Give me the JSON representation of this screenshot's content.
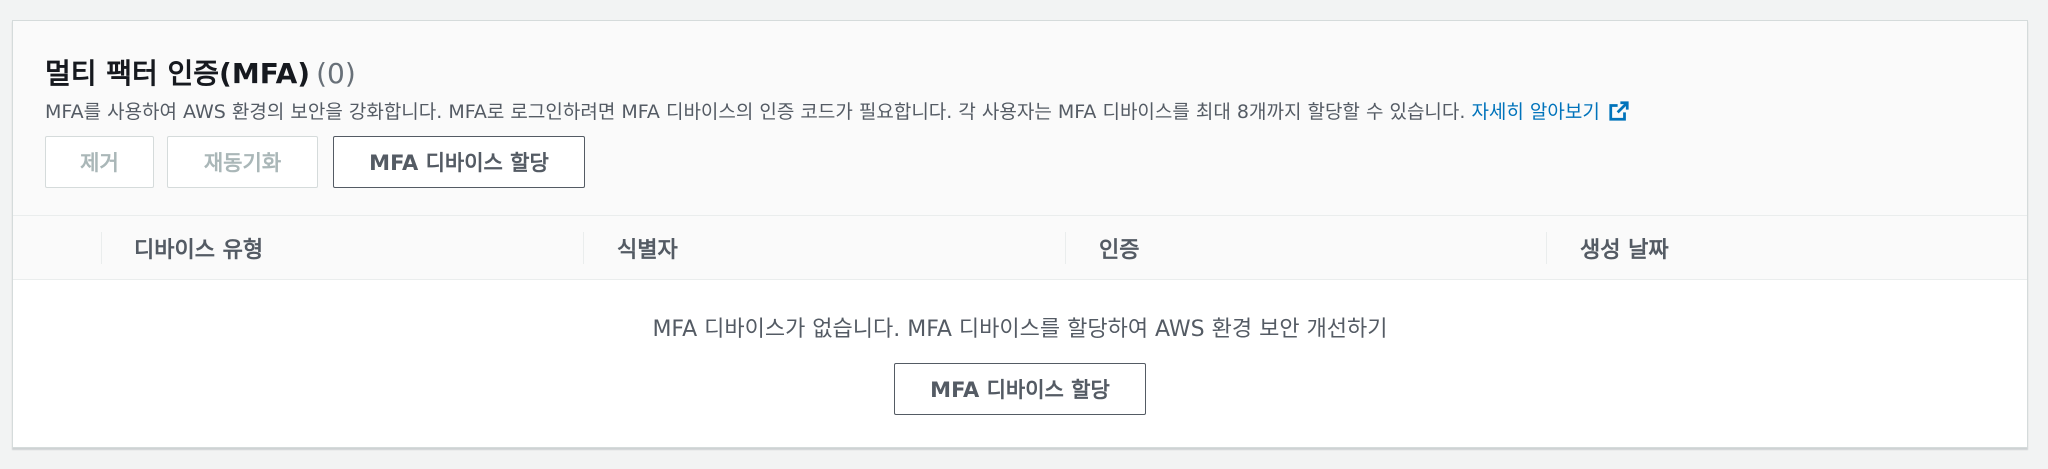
{
  "header": {
    "title": "멀티 팩터 인증(MFA)",
    "count": "(0)",
    "description": "MFA를 사용하여 AWS 환경의 보안을 강화합니다. MFA로 로그인하려면 MFA 디바이스의 인증 코드가 필요합니다. 각 사용자는 MFA 디바이스를 최대 8개까지 할당할 수 있습니다.",
    "learn_more": "자세히 알아보기",
    "link_icon": "external-link-icon"
  },
  "toolbar": {
    "remove_label": "제거",
    "resync_label": "재동기화",
    "assign_label": "MFA 디바이스 할당"
  },
  "table": {
    "columns": [
      "디바이스 유형",
      "식별자",
      "인증",
      "생성 날짜"
    ]
  },
  "empty_state": {
    "message": "MFA 디바이스가 없습니다. MFA 디바이스를 할당하여 AWS 환경 보안 개선하기",
    "button_label": "MFA 디바이스 할당"
  },
  "colors": {
    "link": "#0073bb",
    "text": "#16191f",
    "muted": "#545b64",
    "disabled": "#aab7b8"
  }
}
